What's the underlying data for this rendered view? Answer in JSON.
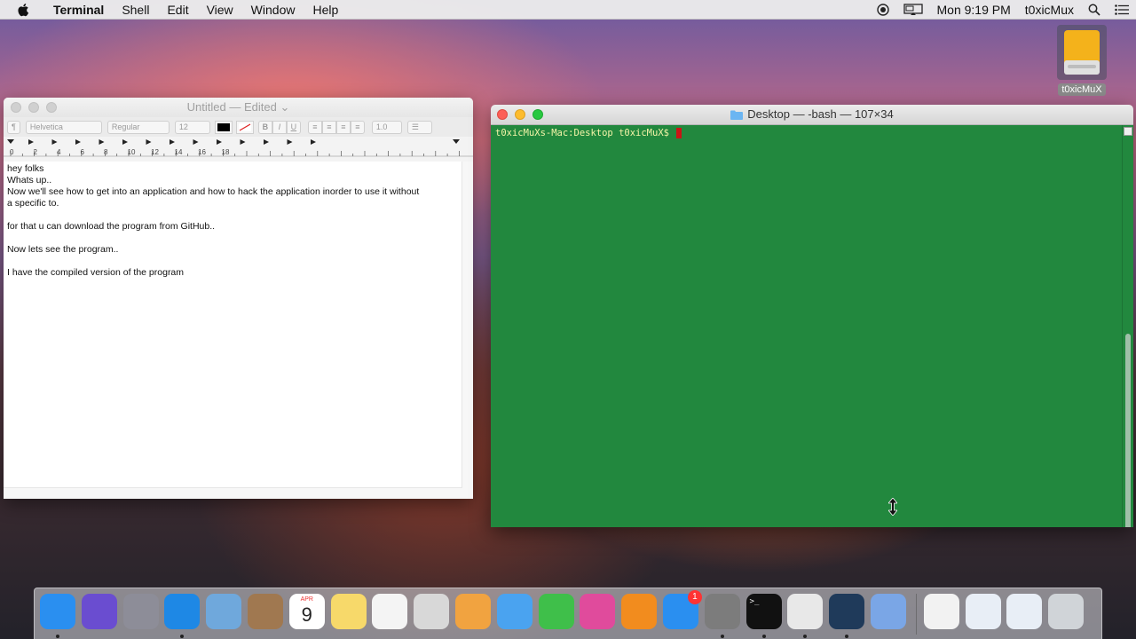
{
  "menubar": {
    "app": "Terminal",
    "items": [
      "Shell",
      "Edit",
      "View",
      "Window",
      "Help"
    ],
    "clock": "Mon 9:19 PM",
    "user": "t0xicMux"
  },
  "desktop": {
    "disk_label": "t0xicMuX"
  },
  "textedit": {
    "title": "Untitled",
    "title_suffix": "— Edited",
    "toolbar": {
      "paragraph_style": "¶",
      "font": "Helvetica",
      "typeface": "Regular",
      "size": "12",
      "bold": "B",
      "italic": "I",
      "underline": "U",
      "spacing": "1.0"
    },
    "ruler_labels": [
      "0",
      "2",
      "4",
      "6",
      "8",
      "10",
      "12",
      "14",
      "16",
      "18"
    ],
    "lines": [
      "hey folks",
      "Whats up..",
      "Now we'll see how to get into an application and how to hack the application inorder to use it without",
      "a specific to.",
      "",
      "for that u can download the program from GitHub..",
      "",
      "Now lets see the program..",
      "",
      "I have the compiled version of the program"
    ]
  },
  "terminal": {
    "title": "Desktop — -bash — 107×34",
    "prompt": "t0xicMuXs-Mac:Desktop t0xicMuX$",
    "colors": {
      "background": "#22883e",
      "text": "#f4f4a8",
      "cursor": "#c91515"
    }
  },
  "dock": {
    "items": [
      {
        "name": "finder-icon",
        "color": "#2a8ff0",
        "running": true
      },
      {
        "name": "siri-icon",
        "color": "#6a4dd0",
        "running": false
      },
      {
        "name": "launchpad-icon",
        "color": "#8d8d98",
        "running": false
      },
      {
        "name": "safari-icon",
        "color": "#1e88e5",
        "running": true
      },
      {
        "name": "mail-icon",
        "color": "#6fa8dc",
        "running": false
      },
      {
        "name": "contacts-icon",
        "color": "#a07850",
        "running": false
      },
      {
        "name": "calendar-icon",
        "color": "#ffffff",
        "running": false
      },
      {
        "name": "notes-icon",
        "color": "#f7d96a",
        "running": false
      },
      {
        "name": "reminders-icon",
        "color": "#f4f4f4",
        "running": false
      },
      {
        "name": "photo-booth-icon",
        "color": "#d8d8d8",
        "running": false
      },
      {
        "name": "photos-icon",
        "color": "#f1a340",
        "running": false
      },
      {
        "name": "messages-icon",
        "color": "#4aa3f0",
        "running": false
      },
      {
        "name": "facetime-icon",
        "color": "#3fbf4a",
        "running": false
      },
      {
        "name": "itunes-icon",
        "color": "#e04b9c",
        "running": false
      },
      {
        "name": "ibooks-icon",
        "color": "#f28c1e",
        "running": false
      },
      {
        "name": "app-store-icon",
        "color": "#2a8ff0",
        "running": false
      },
      {
        "name": "system-preferences-icon",
        "color": "#7c7c7c",
        "running": true
      },
      {
        "name": "terminal-icon",
        "color": "#111111",
        "running": true
      },
      {
        "name": "textedit-icon",
        "color": "#e8e8e8",
        "running": true
      },
      {
        "name": "quicktime-icon",
        "color": "#1f3a5a",
        "running": true
      },
      {
        "name": "document-icon",
        "color": "#7aa6e6",
        "running": false
      }
    ],
    "right_items": [
      {
        "name": "documents-stack-icon",
        "color": "#f2f2f2"
      },
      {
        "name": "downloads-stack-icon",
        "color": "#e8eef6"
      },
      {
        "name": "screenshot-stack-icon",
        "color": "#e8eef6"
      },
      {
        "name": "trash-icon",
        "color": "#d0d4d8"
      }
    ],
    "calendar": {
      "month": "APR",
      "day": "9"
    },
    "app_store_badge": "1"
  }
}
